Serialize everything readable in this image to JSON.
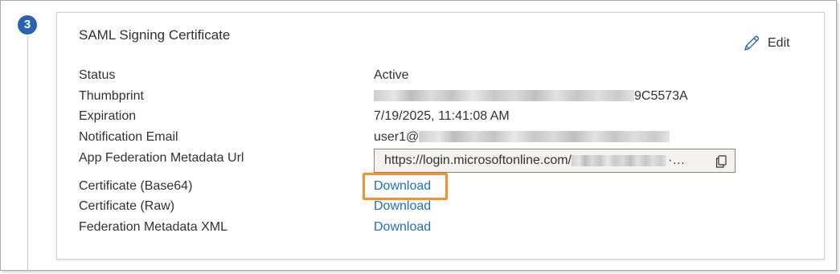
{
  "step": {
    "number": "3"
  },
  "card": {
    "title": "SAML Signing Certificate",
    "edit_label": "Edit"
  },
  "fields": {
    "status": {
      "label": "Status",
      "value": "Active"
    },
    "thumbprint": {
      "label": "Thumbprint",
      "value_suffix": "9C5573A"
    },
    "expiration": {
      "label": "Expiration",
      "value": "7/19/2025, 11:41:08 AM"
    },
    "notification_email": {
      "label": "Notification Email",
      "value_prefix": "user1@"
    },
    "metadata_url": {
      "label": "App Federation Metadata Url",
      "value_prefix": "https://login.microsoftonline.com/",
      "value_end": "·…"
    },
    "cert_base64": {
      "label": "Certificate (Base64)",
      "link": "Download"
    },
    "cert_raw": {
      "label": "Certificate (Raw)",
      "link": "Download"
    },
    "federation_xml": {
      "label": "Federation Metadata XML",
      "link": "Download"
    }
  },
  "icons": {
    "edit": "pencil-icon",
    "copy": "copy-icon"
  },
  "colors": {
    "step_badge": "#2b63b0",
    "link": "#1f6fc5",
    "highlight": "#f5912d"
  }
}
